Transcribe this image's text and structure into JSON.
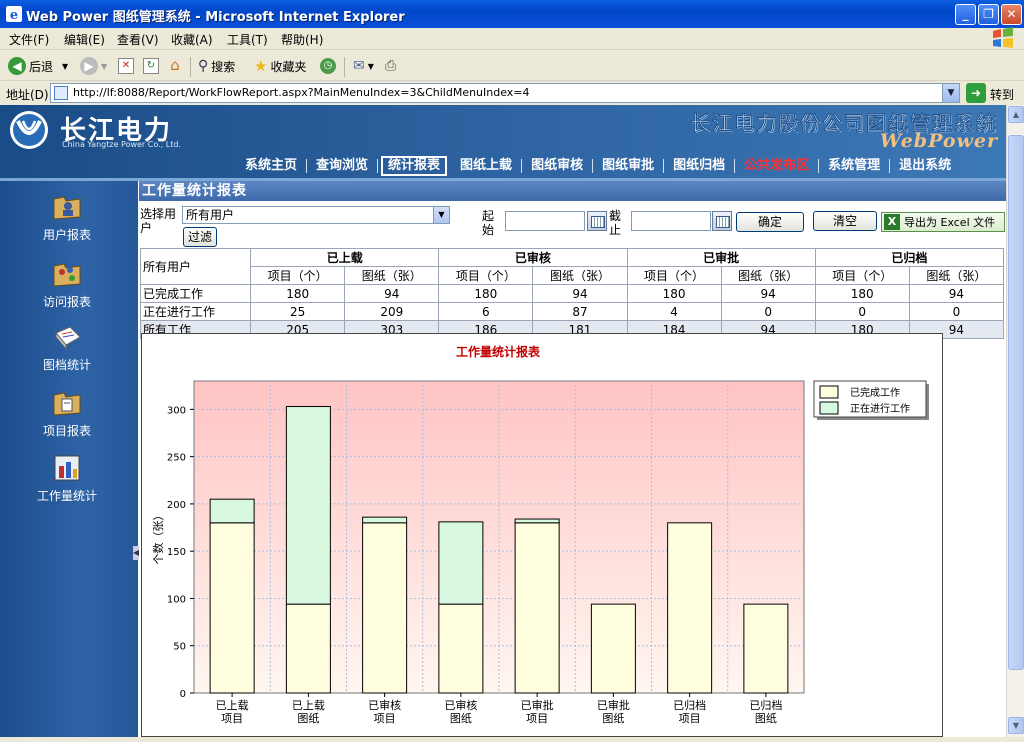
{
  "window": {
    "title": "Web Power 图纸管理系统 - Microsoft Internet Explorer",
    "controls": [
      "_",
      "❐",
      "✕"
    ]
  },
  "menu": [
    "文件(F)",
    "编辑(E)",
    "查看(V)",
    "收藏(A)",
    "工具(T)",
    "帮助(H)"
  ],
  "toolbar": {
    "back": "后退",
    "search": "搜索",
    "favorites": "收藏夹"
  },
  "address": {
    "label": "地址(D)",
    "url": "http://lf:8088/Report/WorkFlowReport.aspx?MainMenuIndex=3&ChildMenuIndex=4",
    "go": "转到"
  },
  "banner": {
    "logo_cn": "长江电力",
    "logo_en": "China Yangtze Power Co., Ltd.",
    "system_cn": "长江电力股份公司图纸管理系统",
    "system_en": "WebPower"
  },
  "nav": [
    {
      "label": "系统主页"
    },
    {
      "label": "查询浏览"
    },
    {
      "label": "统计报表",
      "active": true
    },
    {
      "label": "图纸上载"
    },
    {
      "label": "图纸审核"
    },
    {
      "label": "图纸审批"
    },
    {
      "label": "图纸归档"
    },
    {
      "label": "公共发布区",
      "highlight": true
    },
    {
      "label": "系统管理"
    },
    {
      "label": "退出系统"
    }
  ],
  "sidebar": [
    {
      "label": "用户报表",
      "icon": "folder-user-icon"
    },
    {
      "label": "访问报表",
      "icon": "folder-visit-icon"
    },
    {
      "label": "图档统计",
      "icon": "document-stats-icon"
    },
    {
      "label": "项目报表",
      "icon": "folder-project-icon"
    },
    {
      "label": "工作量统计",
      "icon": "workload-stats-icon"
    }
  ],
  "section_title": "工作量统计报表",
  "filter": {
    "user_label": "选择用户",
    "user_value": "所有用户",
    "filter_button": "过滤",
    "start_label": "起始",
    "end_label": "截止",
    "confirm_button": "确定",
    "clear_button": "清空",
    "export_button": "导出为 Excel 文件"
  },
  "table": {
    "corner": "所有用户",
    "groups": [
      "已上载",
      "已审核",
      "已审批",
      "已归档"
    ],
    "sub_headers": [
      "项目（个）",
      "图纸（张）"
    ],
    "rows": [
      {
        "label": "已完成工作",
        "values": [
          "180",
          "94",
          "180",
          "94",
          "180",
          "94",
          "180",
          "94"
        ]
      },
      {
        "label": "正在进行工作",
        "values": [
          "25",
          "209",
          "6",
          "87",
          "4",
          "0",
          "0",
          "0"
        ]
      },
      {
        "label": "所有工作",
        "values": [
          "205",
          "303",
          "186",
          "181",
          "184",
          "94",
          "180",
          "94"
        ]
      }
    ]
  },
  "chart_data": {
    "type": "bar",
    "stacked": true,
    "title": "工作量统计报表",
    "ylabel": "个数（张）",
    "xlabel": "",
    "ylim": [
      0,
      330
    ],
    "yticks": [
      0,
      50,
      100,
      150,
      200,
      250,
      300
    ],
    "grid": true,
    "legend_position": "top-right",
    "categories": [
      [
        "已上载",
        "项目"
      ],
      [
        "已上载",
        "图纸"
      ],
      [
        "已审核",
        "项目"
      ],
      [
        "已审核",
        "图纸"
      ],
      [
        "已审批",
        "项目"
      ],
      [
        "已审批",
        "图纸"
      ],
      [
        "已归档",
        "项目"
      ],
      [
        "已归档",
        "图纸"
      ]
    ],
    "series": [
      {
        "name": "已完成工作",
        "color": "#ffffe0",
        "values": [
          180,
          94,
          180,
          94,
          180,
          94,
          180,
          94
        ]
      },
      {
        "name": "正在进行工作",
        "color": "#d8f8e0",
        "values": [
          25,
          209,
          6,
          87,
          4,
          0,
          0,
          0
        ]
      }
    ]
  }
}
